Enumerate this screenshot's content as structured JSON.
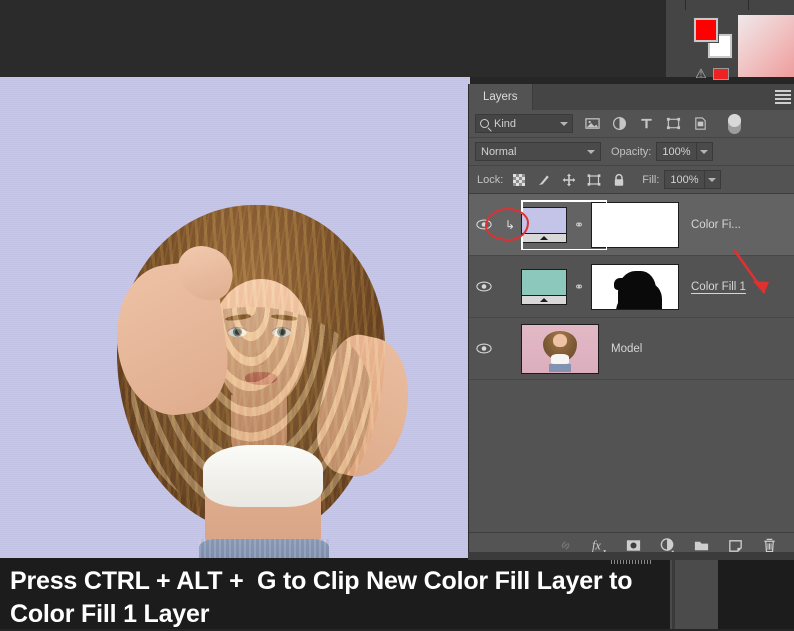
{
  "app": {
    "title": "Adobe Photoshop",
    "canvas_background_color": "#c5c6e8",
    "foreground_color": "#ff0000",
    "background_color": "#ffffff"
  },
  "toolbar": {
    "foreground_swatch_name": "foreground-color",
    "background_swatch_name": "background-color",
    "warning_glyph": "⚠",
    "collapse_glyph": "«",
    "expand_glyph": "»"
  },
  "panel": {
    "tab_label": "Layers",
    "menu_icon": "hamburger-menu-icon",
    "filter": {
      "kind_label": "Kind",
      "search_icon": "search-icon",
      "caret_icon": "chevron-down-icon",
      "icons": [
        "pixel-layer-filter-icon",
        "adjustment-layer-filter-icon",
        "type-layer-filter-icon",
        "shape-layer-filter-icon",
        "smart-object-filter-icon"
      ],
      "toggle_name": "filter-toggle"
    },
    "blend": {
      "mode": "Normal",
      "opacity_label": "Opacity:",
      "opacity_value": "100%",
      "fill_label": "Fill:",
      "fill_value": "100%"
    },
    "lock": {
      "label": "Lock:",
      "icons": [
        "lock-transparent-pixels-icon",
        "lock-image-pixels-icon",
        "lock-position-icon",
        "lock-artboard-nesting-icon",
        "lock-all-icon"
      ]
    },
    "layers": [
      {
        "name": "Color Fi...",
        "visible": true,
        "selected": true,
        "clipped": true,
        "clip_glyph": "↳",
        "fill_color": "#c3c4e8",
        "mask": "white",
        "link_glyph": "⚭",
        "eye_icon": "eye-visibility-icon"
      },
      {
        "name": "Color Fill 1",
        "visible": true,
        "selected": false,
        "clipped": false,
        "fill_color": "#8cc9bc",
        "mask": "silhouette",
        "link_glyph": "⚭",
        "eye_icon": "eye-visibility-icon",
        "underlined": true
      },
      {
        "name": "Model",
        "visible": true,
        "selected": false,
        "clipped": false,
        "mask": "none",
        "eye_icon": "eye-visibility-icon"
      }
    ],
    "bottom_buttons": [
      "link-layers-icon",
      "layer-style-fx-icon",
      "add-layer-mask-icon",
      "new-adjustment-layer-icon",
      "new-group-icon",
      "new-layer-icon",
      "delete-layer-icon"
    ]
  },
  "annotations": {
    "circle_target": "clipping-mask-arrow",
    "arrow_target": "Color Fill 1",
    "annotation_color": "#e03030"
  },
  "caption": {
    "text": "Press CTRL + ALT +  G to Clip New Color Fill Layer to Color Fill 1 Layer"
  }
}
